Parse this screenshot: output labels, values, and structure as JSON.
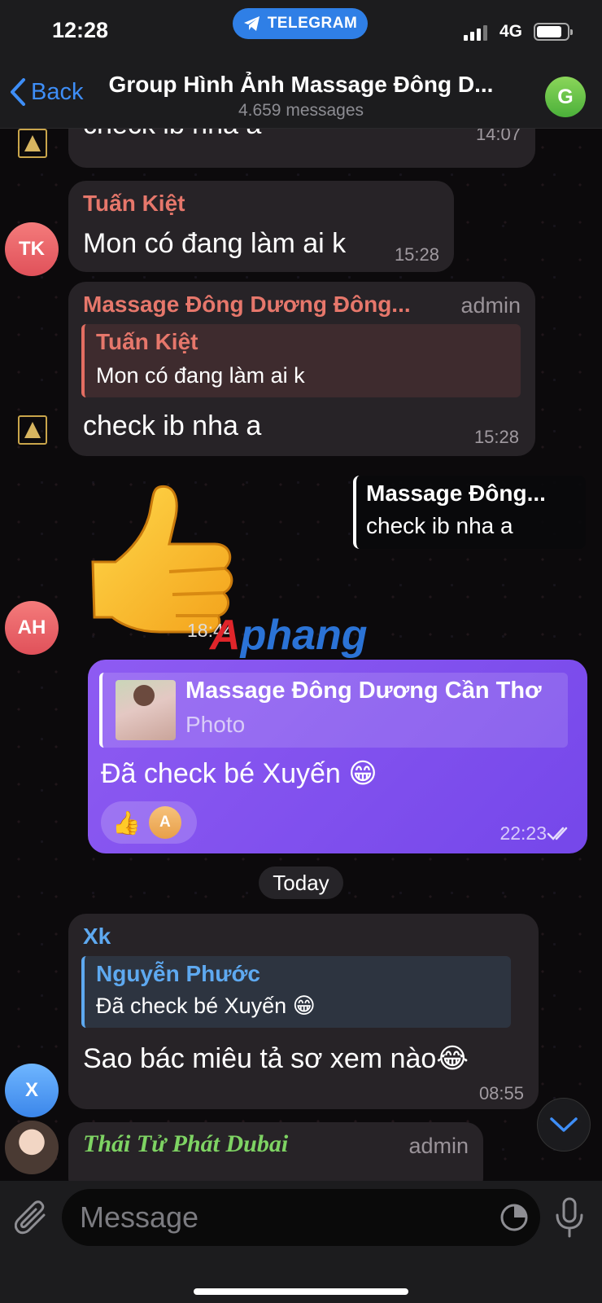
{
  "status_bar": {
    "time": "12:28",
    "app_pill": "TELEGRAM",
    "network": "4G"
  },
  "header": {
    "back_label": "Back",
    "title": "Group Hình Ảnh Massage Đông D...",
    "subtitle": "4.659 messages",
    "avatar_letter": "G"
  },
  "messages": {
    "m1": {
      "text": "check ib nha a",
      "time": "14:07"
    },
    "m2": {
      "sender": "Tuấn Kiệt",
      "avatar": "TK",
      "text": "Mon có đang làm ai k",
      "time": "15:28"
    },
    "m3": {
      "sender": "Massage Đông Dương Đông...",
      "role": "admin",
      "reply_name": "Tuấn Kiệt",
      "reply_text": "Mon có đang làm ai k",
      "text": "check ib nha a",
      "time": "15:28"
    },
    "m4": {
      "avatar": "AH",
      "reply_name": "Massage Đông...",
      "reply_text": "check ib nha a",
      "time": "18:44",
      "emoji": "👍"
    },
    "m5": {
      "reply_name": "Massage Đông Dương Cần Thơ",
      "reply_text": "Photo",
      "text": "Đã check bé Xuyến 😁",
      "reaction_emoji": "👍",
      "reaction_avatar": "A",
      "time": "22:23"
    },
    "date_separator": "Today",
    "m6": {
      "sender": "Xk",
      "avatar": "X",
      "reply_name": "Nguyễn Phước",
      "reply_text": "Đã check bé Xuyến 😁",
      "text": "Sao bác miêu tả sơ xem nào😂",
      "time": "08:55"
    },
    "m7": {
      "sender": "Thái Tử Phát Dubai",
      "role": "admin"
    }
  },
  "watermark": {
    "part1": "A",
    "part2": "phang"
  },
  "input": {
    "placeholder": "Message"
  },
  "colors": {
    "accent": "#3e8ef7",
    "outgoing_bubble": "#7d4fee",
    "incoming_bubble": "#272327",
    "sender_red": "#e6776b",
    "sender_blue": "#5ea9f0",
    "sender_green": "#7ed363"
  }
}
